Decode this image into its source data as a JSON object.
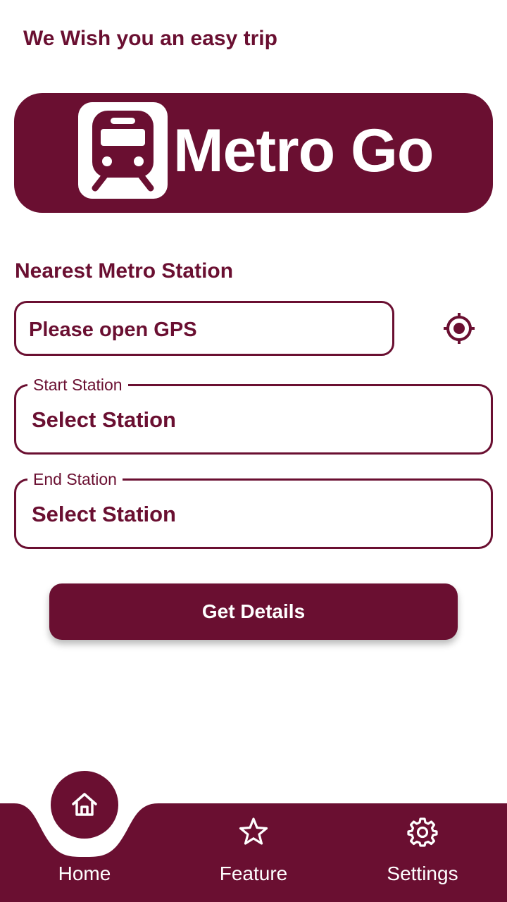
{
  "header": {
    "greeting": "We Wish you an easy trip"
  },
  "banner": {
    "app_name": "Metro Go",
    "logo_icon": "metro-train-icon"
  },
  "nearest": {
    "label": "Nearest Metro Station",
    "value": "Please open GPS",
    "locate_icon": "gps-target-icon"
  },
  "start_station": {
    "label": "Start Station",
    "value": "Select Station"
  },
  "end_station": {
    "label": "End Station",
    "value": "Select Station"
  },
  "actions": {
    "get_details_label": "Get Details"
  },
  "nav": {
    "items": [
      {
        "label": "Home",
        "icon": "home-icon",
        "active": true
      },
      {
        "label": "Feature",
        "icon": "star-icon",
        "active": false
      },
      {
        "label": "Settings",
        "icon": "gear-icon",
        "active": false
      }
    ]
  },
  "colors": {
    "primary": "#6a0f31",
    "background": "#ffffff",
    "on_primary": "#ffffff"
  }
}
